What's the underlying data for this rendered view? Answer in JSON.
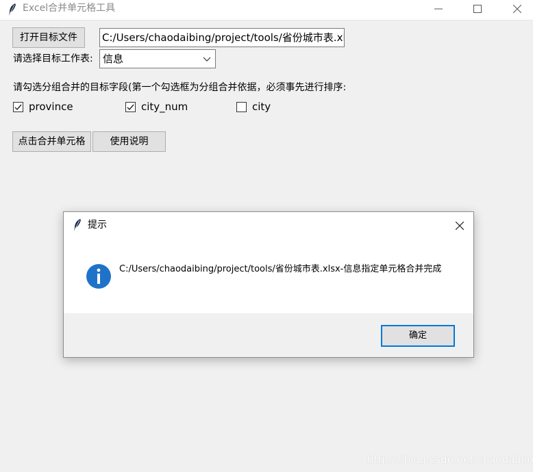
{
  "window": {
    "title": "Excel合并单元格工具",
    "icons": {
      "app": "feather-icon",
      "minimize": "minimize-icon",
      "maximize": "maximize-icon",
      "close": "close-icon"
    }
  },
  "form": {
    "open_button_label": "打开目标文件",
    "file_path_value": "C:/Users/chaodaibing/project/tools/省份城市表.xlsx",
    "sheet_label": "请选择目标工作表:",
    "sheet_selected": "信息",
    "instructions": "请勾选分组合并的目标字段(第一个勾选框为分组合并依据，必须事先进行排序:",
    "checkboxes": [
      {
        "label": "province",
        "checked": true
      },
      {
        "label": "city_num",
        "checked": true
      },
      {
        "label": "city",
        "checked": false
      }
    ],
    "merge_button_label": "点击合并单元格",
    "help_button_label": "使用说明"
  },
  "dialog": {
    "title": "提示",
    "icon": "info-icon",
    "message": "C:/Users/chaodaibing/project/tools/省份城市表.xlsx-信息指定单元格合并完成",
    "ok_label": "确定"
  },
  "watermark": "https://blog.csdn.net/chaodaibing",
  "colors": {
    "accent": "#0078d7",
    "info_blue": "#1e73c8",
    "window_bg": "#f0f0f0"
  }
}
